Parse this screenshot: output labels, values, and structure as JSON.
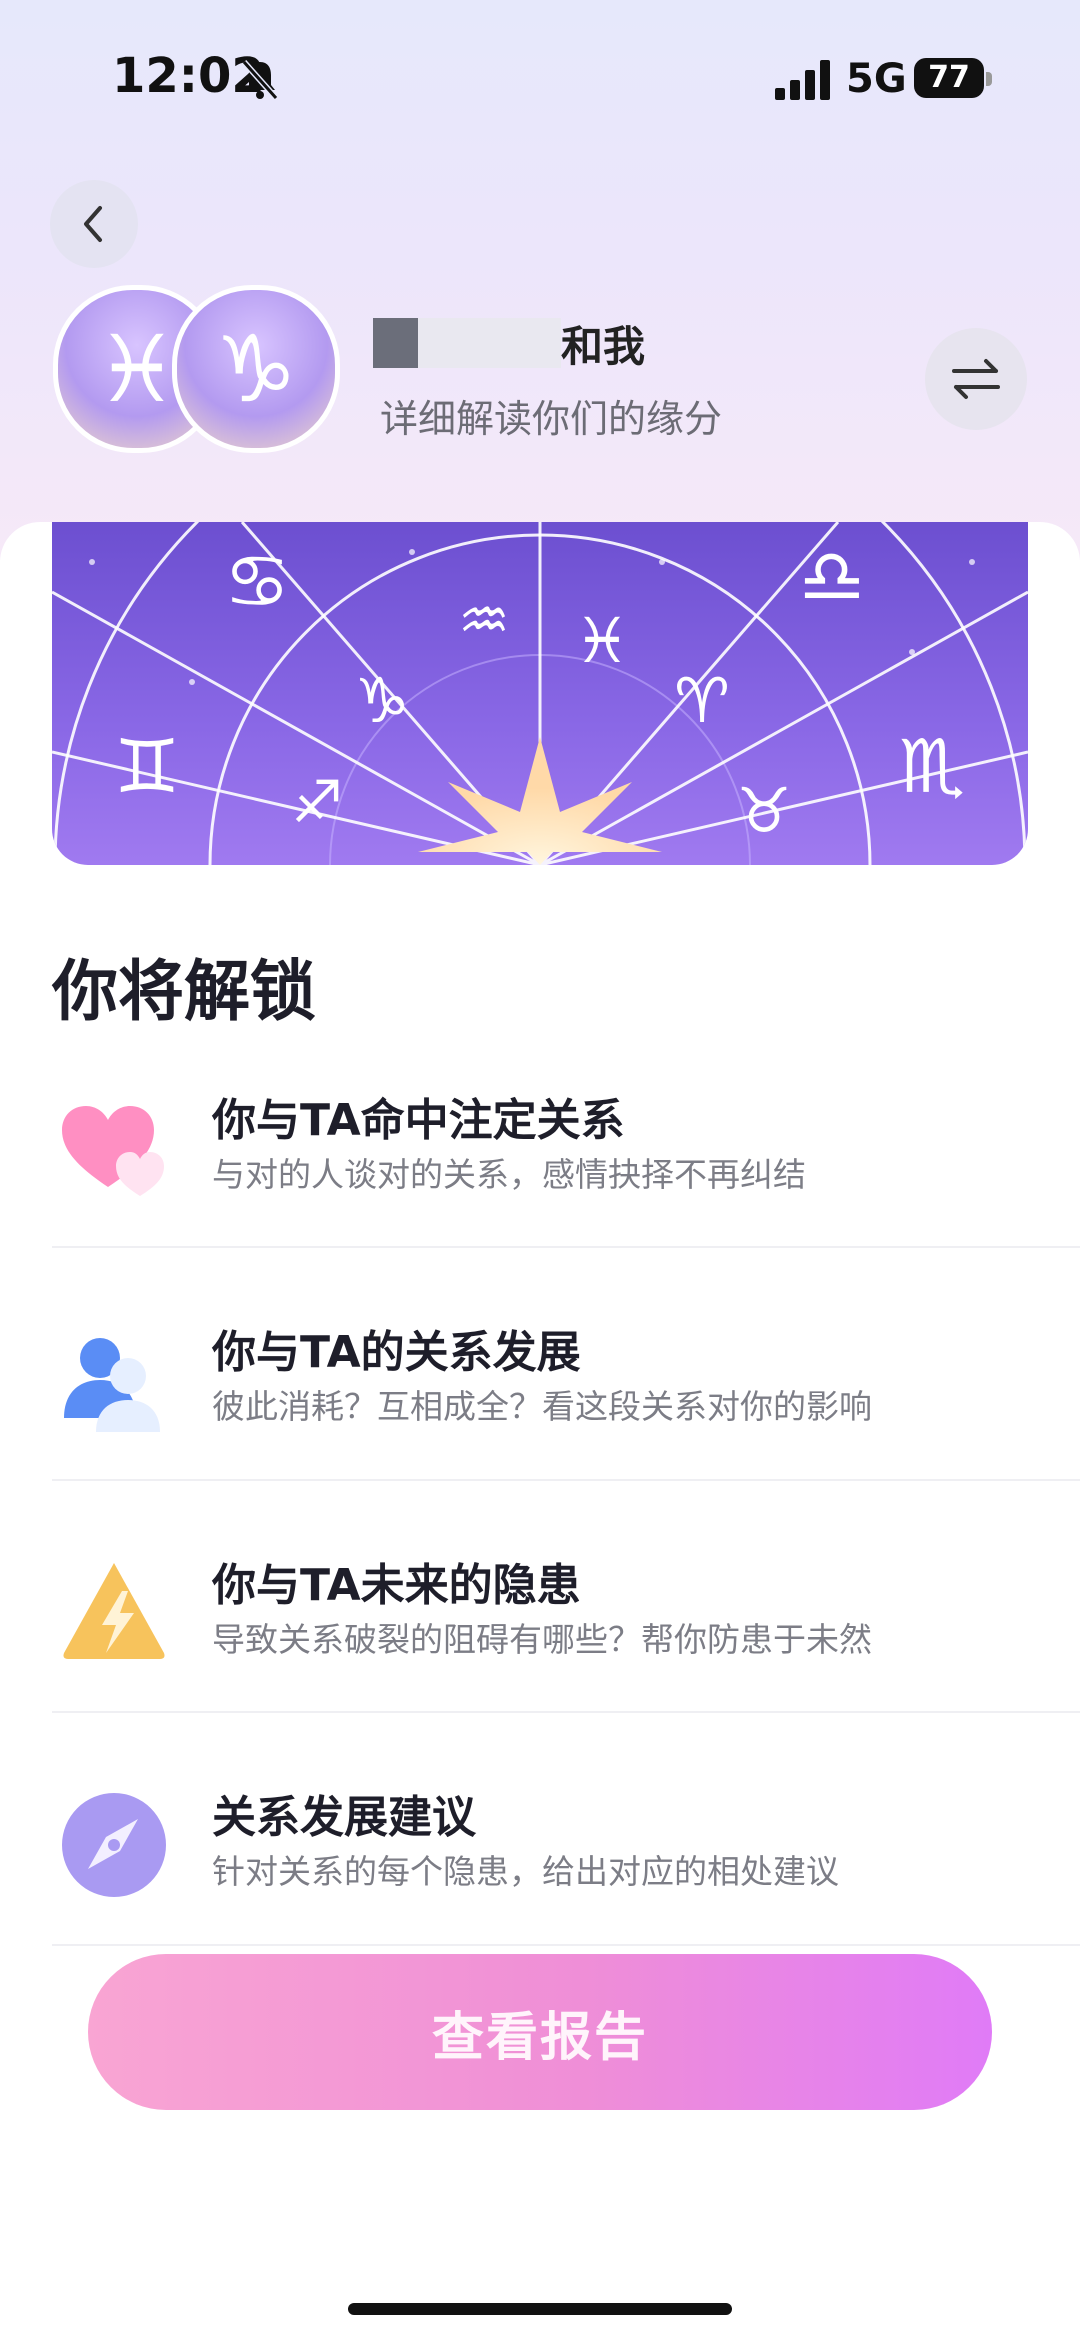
{
  "status": {
    "time": "12:02",
    "network": "5G",
    "battery": "77"
  },
  "header": {
    "back_icon": "chevron-left-icon",
    "sign_left": "♓",
    "sign_right": "♑",
    "name_suffix": "和我",
    "subtitle": "详细解读你们的缘分",
    "swap_icon": "swap-arrows-icon"
  },
  "section": {
    "title": "你将解锁"
  },
  "items": [
    {
      "title": "你与TA命中注定关系",
      "desc": "与对的人谈对的关系，感情抉择不再纠结",
      "icon": "hearts-icon"
    },
    {
      "title": "你与TA的关系发展",
      "desc": "彼此消耗？互相成全？看这段关系对你的影响",
      "icon": "people-icon"
    },
    {
      "title": "你与TA未来的隐患",
      "desc": "导致关系破裂的阻碍有哪些？帮你防患于未然",
      "icon": "warning-bolt-icon"
    },
    {
      "title": "关系发展建议",
      "desc": "针对关系的每个隐患，给出对应的相处建议",
      "icon": "compass-icon"
    }
  ],
  "cta": {
    "label": "查看报告"
  },
  "colors": {
    "cta_start": "#f9a5d3",
    "cta_end": "#e07bf7",
    "wheel_bg": "#7a5ad9"
  }
}
